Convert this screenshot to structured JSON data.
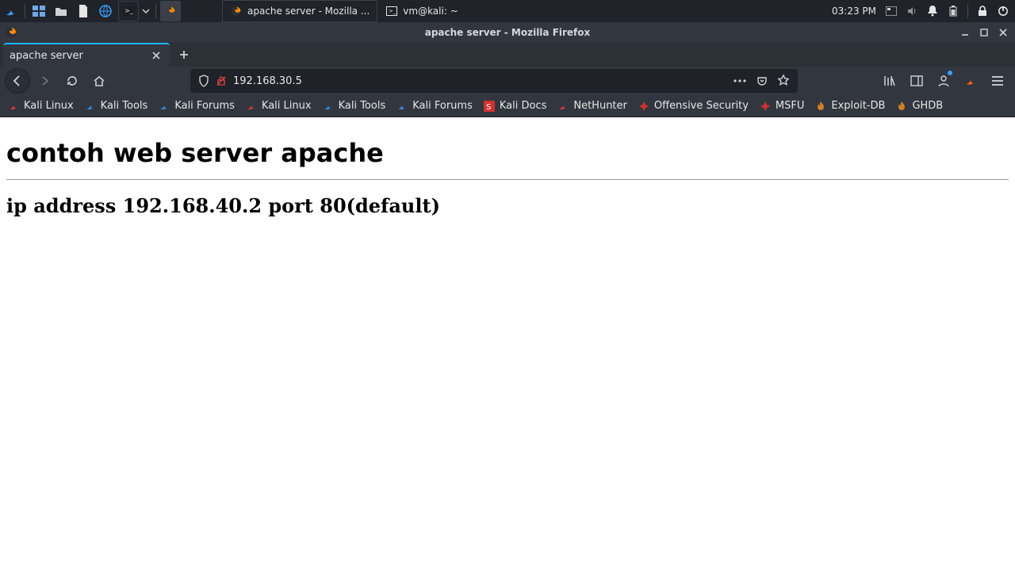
{
  "os_panel": {
    "taskbar": [
      {
        "label": "apache server - Mozilla ...",
        "icon": "firefox"
      },
      {
        "label": "vm@kali: ~",
        "icon": "terminal"
      }
    ],
    "clock": "03:23 PM"
  },
  "firefox": {
    "window_title": "apache server - Mozilla Firefox",
    "tab_title": "apache server",
    "url": "192.168.30.5",
    "bookmarks": [
      {
        "label": "Kali Linux",
        "favicon": "kali"
      },
      {
        "label": "Kali Tools",
        "favicon": "tools"
      },
      {
        "label": "Kali Forums",
        "favicon": "tools"
      },
      {
        "label": "Kali Linux",
        "favicon": "kali"
      },
      {
        "label": "Kali Tools",
        "favicon": "tools"
      },
      {
        "label": "Kali Forums",
        "favicon": "tools"
      },
      {
        "label": "Kali Docs",
        "favicon": "s"
      },
      {
        "label": "NetHunter",
        "favicon": "kali"
      },
      {
        "label": "Offensive Security",
        "favicon": "dark"
      },
      {
        "label": "MSFU",
        "favicon": "dark"
      },
      {
        "label": "Exploit-DB",
        "favicon": "flame"
      },
      {
        "label": "GHDB",
        "favicon": "flame"
      }
    ]
  },
  "page": {
    "heading": "contoh web server apache",
    "subheading": "ip address 192.168.40.2 port 80(default)"
  }
}
